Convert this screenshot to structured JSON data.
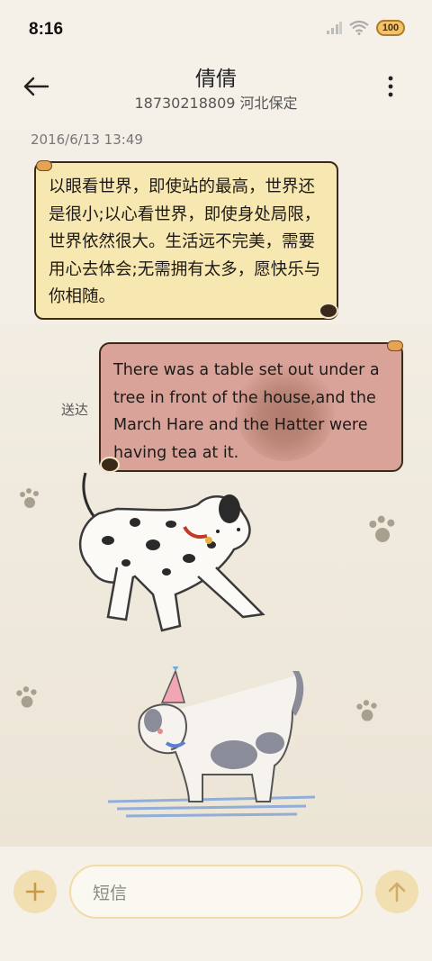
{
  "status_bar": {
    "time": "8:16",
    "battery": "100"
  },
  "header": {
    "contact_name": "倩倩",
    "contact_sub": "18730218809 河北保定"
  },
  "conversation": {
    "timestamp": "2016/6/13 13:49",
    "incoming_message": "以眼看世界，即使站的最高，世界还是很小;以心看世界，即使身处局限，世界依然很大。生活远不完美，需要用心去体会;无需拥有太多，愿快乐与你相随。",
    "outgoing_message": "There was a table set out under a tree in front of the house,and the March Hare and the Hatter were having tea at it.",
    "outgoing_status": "送达"
  },
  "composer": {
    "placeholder": "短信"
  },
  "icons": {
    "back": "back-arrow-icon",
    "more": "more-vertical-icon",
    "add": "plus-icon",
    "send": "send-arrow-icon"
  },
  "colors": {
    "incoming_bubble": "#f7e7b0",
    "outgoing_bubble": "#d9a39a",
    "accent": "#f1dfb2"
  }
}
